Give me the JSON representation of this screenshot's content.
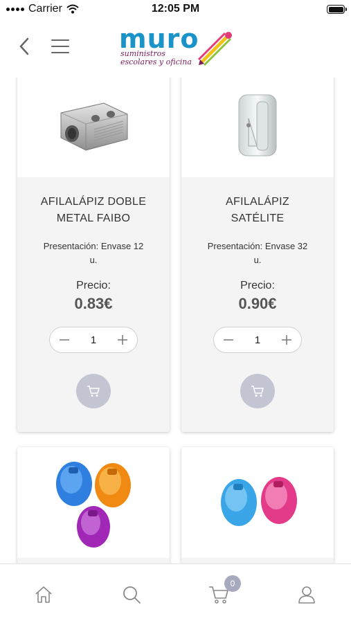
{
  "status_bar": {
    "carrier": "Carrier",
    "time": "12:05 PM"
  },
  "header": {
    "logo_word": "muro",
    "logo_sub_line1": "suministros",
    "logo_sub_line2": "escolares y oficina",
    "back_icon": "chevron-left-icon",
    "menu_icon": "hamburger-icon"
  },
  "products": [
    {
      "name_line1": "AFILALÁPIZ DOBLE",
      "name_line2": "METAL FAIBO",
      "presentation_line1": "Presentación: Envase 12",
      "presentation_line2": "u.",
      "price_label": "Precio:",
      "price": "0.83€",
      "quantity": "1"
    },
    {
      "name_line1": "AFILALÁPIZ",
      "name_line2": "SATÉLITE",
      "presentation_line1": "Presentación: Envase 32",
      "presentation_line2": "u.",
      "price_label": "Precio:",
      "price": "0.90€",
      "quantity": "1"
    },
    {
      "image": "colored-sharpeners-three"
    },
    {
      "image": "colored-sharpeners-two"
    }
  ],
  "tab_bar": {
    "items": [
      "home-icon",
      "search-icon",
      "cart-icon",
      "user-icon"
    ],
    "cart_count": "0"
  },
  "colors": {
    "brand_blue": "#1a93c8",
    "cart_button": "#c3c5d3",
    "card_bg": "#f4f4f4",
    "badge": "#a7aabf"
  }
}
